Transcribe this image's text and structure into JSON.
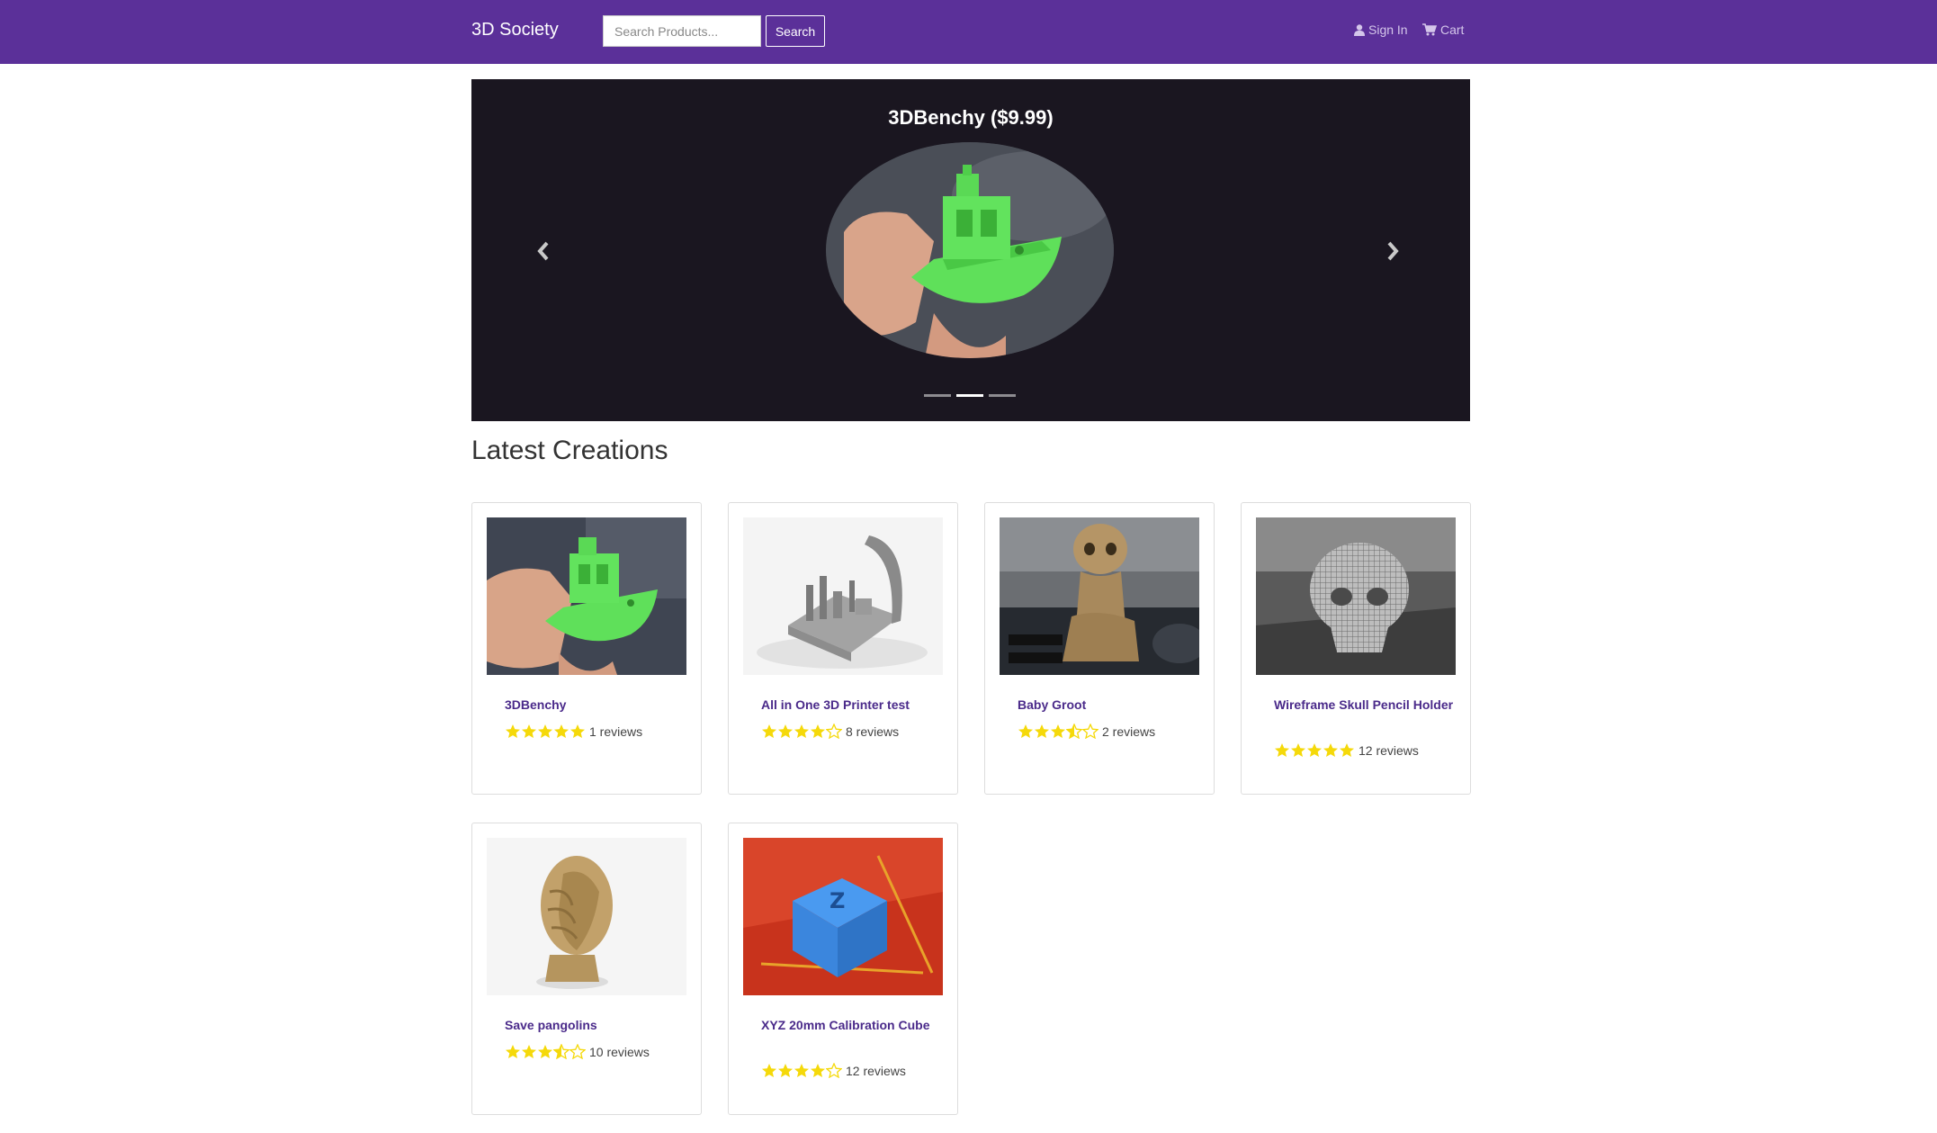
{
  "nav": {
    "brand": "3D Society",
    "search_placeholder": "Search Products...",
    "search_label": "Search",
    "signin_label": "Sign In",
    "cart_label": "Cart"
  },
  "carousel": {
    "title": "3DBenchy ($9.99)",
    "indicators": 3,
    "active_index": 1
  },
  "section_title": "Latest Creations",
  "products": [
    {
      "name": "3DBenchy",
      "rating": 5,
      "reviews": "1 reviews",
      "image": "green-boat-image"
    },
    {
      "name": "All in One 3D Printer test",
      "rating": 4,
      "reviews": "8 reviews",
      "image": "printer-test-image"
    },
    {
      "name": "Baby Groot",
      "rating": 3.5,
      "reviews": "2 reviews",
      "image": "groot-image"
    },
    {
      "name": "Wireframe Skull Pencil Holder",
      "rating": 5,
      "reviews": "12 reviews",
      "image": "skull-image"
    },
    {
      "name": "Save pangolins",
      "rating": 3.5,
      "reviews": "10 reviews",
      "image": "pangolin-image"
    },
    {
      "name": "XYZ 20mm Calibration Cube",
      "rating": 4,
      "reviews": "12 reviews",
      "image": "calibration-cube-image"
    }
  ],
  "colors": {
    "navbar": "#5b3099",
    "star": "#f5d90a",
    "product_link": "#4a2a8a",
    "carousel_bg": "#1a1620"
  }
}
